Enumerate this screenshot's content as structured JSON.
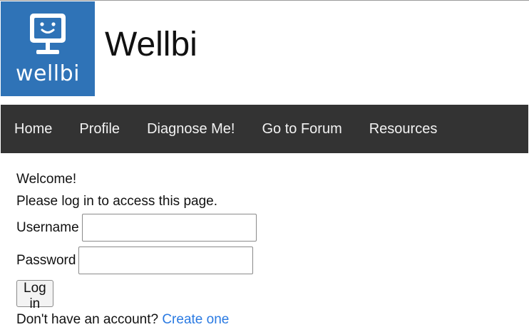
{
  "header": {
    "logo_text": "wellbi",
    "logo_icon": "smiling-monitor-icon",
    "logo_color": "#2f73b7",
    "site_title": "Wellbi"
  },
  "nav": {
    "background": "#333333",
    "items": [
      {
        "label": "Home"
      },
      {
        "label": "Profile"
      },
      {
        "label": "Diagnose Me!"
      },
      {
        "label": "Go to Forum"
      },
      {
        "label": "Resources"
      }
    ]
  },
  "login": {
    "welcome": "Welcome!",
    "subtitle": "Please log in to access this page.",
    "username_label": "Username",
    "username_value": "",
    "password_label": "Password",
    "password_value": "",
    "submit_label": "Log in",
    "signup_prompt": "Don't have an account?",
    "signup_link": "Create one",
    "link_color": "#2a7ae2"
  }
}
